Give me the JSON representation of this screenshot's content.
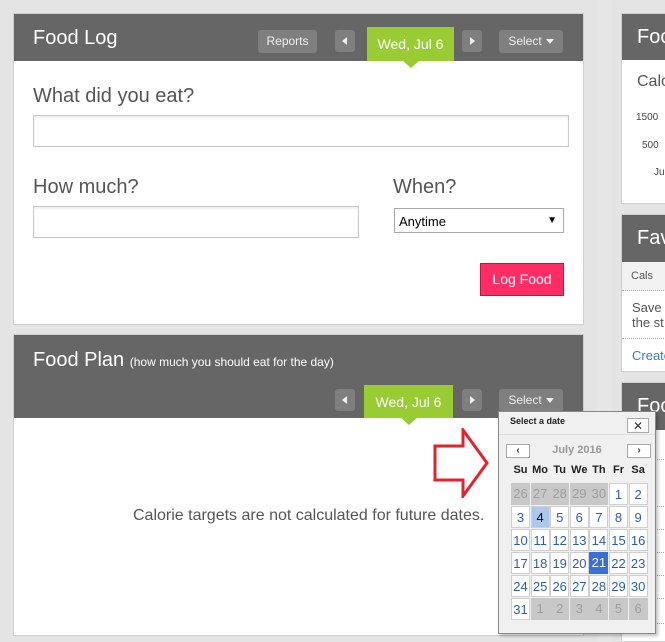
{
  "food_log": {
    "title": "Food Log",
    "reports_label": "Reports",
    "date_label": "Wed, Jul 6",
    "select_label": "Select",
    "what_label": "What did you eat?",
    "what_value": "",
    "how_much_label": "How much?",
    "how_much_value": "",
    "when_label": "When?",
    "when_value": "Anytime",
    "log_button": "Log Food"
  },
  "food_plan": {
    "title": "Food Plan",
    "subtitle": "(how much you should eat for the day)",
    "date_label": "Wed, Jul 6",
    "select_label": "Select",
    "message": "Calorie targets are not calculated for future dates."
  },
  "right_column": {
    "panel1": {
      "title": "Foo",
      "subtitle": "Calo",
      "y_labels": [
        "1500",
        "500"
      ],
      "x_label": "Ju"
    },
    "panel2": {
      "title": "Fav",
      "col_header": "Cals",
      "text_line1": "Save",
      "text_line2": "the st",
      "link": "Create"
    },
    "panel3": {
      "title": "Foo"
    }
  },
  "datepicker": {
    "header": "Select a date",
    "close_icon": "✕",
    "prev_icon": "‹",
    "next_icon": "›",
    "month_label": "July 2016",
    "weekdays": [
      "Su",
      "Mo",
      "Tu",
      "We",
      "Th",
      "Fr",
      "Sa"
    ],
    "weeks": [
      [
        {
          "d": "26",
          "t": "other"
        },
        {
          "d": "27",
          "t": "other"
        },
        {
          "d": "28",
          "t": "other"
        },
        {
          "d": "29",
          "t": "other"
        },
        {
          "d": "30",
          "t": "other"
        },
        {
          "d": "1",
          "t": "cur"
        },
        {
          "d": "2",
          "t": "cur"
        }
      ],
      [
        {
          "d": "3",
          "t": "cur"
        },
        {
          "d": "4",
          "t": "today"
        },
        {
          "d": "5",
          "t": "cur"
        },
        {
          "d": "6",
          "t": "cur"
        },
        {
          "d": "7",
          "t": "cur"
        },
        {
          "d": "8",
          "t": "cur"
        },
        {
          "d": "9",
          "t": "cur"
        }
      ],
      [
        {
          "d": "10",
          "t": "cur"
        },
        {
          "d": "11",
          "t": "cur"
        },
        {
          "d": "12",
          "t": "cur"
        },
        {
          "d": "13",
          "t": "cur"
        },
        {
          "d": "14",
          "t": "cur"
        },
        {
          "d": "15",
          "t": "cur"
        },
        {
          "d": "16",
          "t": "cur"
        }
      ],
      [
        {
          "d": "17",
          "t": "cur"
        },
        {
          "d": "18",
          "t": "cur"
        },
        {
          "d": "19",
          "t": "cur"
        },
        {
          "d": "20",
          "t": "cur"
        },
        {
          "d": "21",
          "t": "sel"
        },
        {
          "d": "22",
          "t": "cur"
        },
        {
          "d": "23",
          "t": "cur"
        }
      ],
      [
        {
          "d": "24",
          "t": "cur"
        },
        {
          "d": "25",
          "t": "cur"
        },
        {
          "d": "26",
          "t": "cur"
        },
        {
          "d": "27",
          "t": "cur"
        },
        {
          "d": "28",
          "t": "cur"
        },
        {
          "d": "29",
          "t": "cur"
        },
        {
          "d": "30",
          "t": "cur"
        }
      ],
      [
        {
          "d": "31",
          "t": "cur"
        },
        {
          "d": "1",
          "t": "other"
        },
        {
          "d": "2",
          "t": "other"
        },
        {
          "d": "3",
          "t": "other"
        },
        {
          "d": "4",
          "t": "other"
        },
        {
          "d": "5",
          "t": "other"
        },
        {
          "d": "6",
          "t": "other"
        }
      ]
    ]
  },
  "colors": {
    "header_bg": "#666666",
    "date_green": "#99cc33",
    "log_button": "#ff2d64",
    "selected_day": "#3a6fd8",
    "today_day": "#aac8ee",
    "annotation_arrow": "#e8202a"
  }
}
